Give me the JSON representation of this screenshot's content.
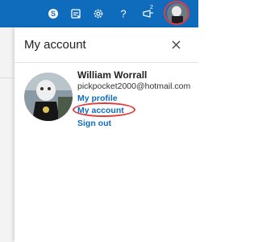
{
  "header": {
    "icons": [
      "skype-icon",
      "whats-new-icon",
      "settings-icon",
      "help-icon",
      "feedback-icon",
      "avatar"
    ],
    "notification_count": "2",
    "brand_color": "#0f6cbd",
    "highlight_color": "#e13d3d"
  },
  "account_panel": {
    "title": "My account",
    "close_icon": "close-icon",
    "user": {
      "name": "William Worrall",
      "email": "pickpocket2000@hotmail.com"
    },
    "links": {
      "profile": "My profile",
      "account": "My account",
      "sign_out": "Sign out"
    }
  }
}
